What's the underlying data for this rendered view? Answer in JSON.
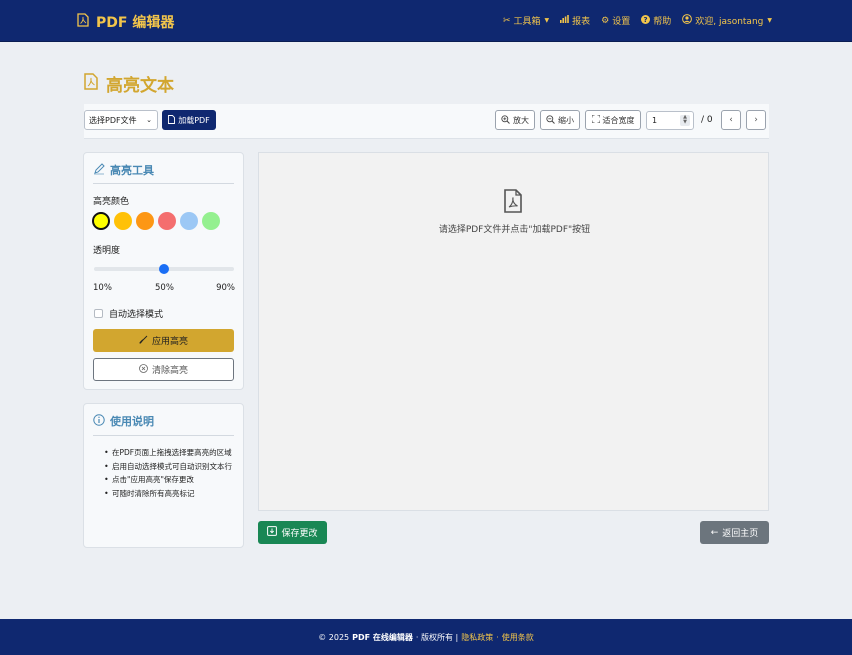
{
  "colors": {
    "navbar_bg": "#0f2870",
    "brand_gold": "#f2c54b",
    "title_gold": "#d2a62f",
    "card_title_blue": "#4a89b4",
    "save_green": "#198754",
    "home_gray": "#6c757d",
    "slider_blue": "#1a6ef5"
  },
  "navbar": {
    "brand": "PDF 编辑器",
    "brand_icon": "file-pdf-icon",
    "items": [
      {
        "label": "工具箱",
        "icon": "tools-icon",
        "dropdown": true
      },
      {
        "label": "报表",
        "icon": "bar-chart-icon",
        "dropdown": false
      },
      {
        "label": "设置",
        "icon": "gear-icon",
        "dropdown": false
      },
      {
        "label": "帮助",
        "icon": "question-circle-icon",
        "dropdown": false
      }
    ],
    "user": {
      "label": "欢迎, jasontang",
      "icon": "user-circle-icon",
      "dropdown": true
    }
  },
  "page": {
    "title": "高亮文本",
    "title_icon": "file-pdf-icon"
  },
  "toolbar": {
    "select_value": "选择PDF文件",
    "load_label": "加载PDF",
    "zoom_in_label": "放大",
    "zoom_out_label": "缩小",
    "fit_width_label": "适合宽度",
    "page_number": "1",
    "page_total": "/ 0",
    "prev_icon": "chevron-left-icon",
    "next_icon": "chevron-right-icon"
  },
  "highlight_tools": {
    "title": "高亮工具",
    "color_label": "高亮颜色",
    "colors": [
      "#ffff00",
      "#ffc107",
      "#fd9714",
      "#f46e6e",
      "#9cc8f5",
      "#94f08f"
    ],
    "selected_color_index": 0,
    "opacity_label": "透明度",
    "opacity_value": 0.5,
    "opacity_ticks": [
      "10%",
      "50%",
      "90%"
    ],
    "auto_select_label": "自动选择模式",
    "auto_select_checked": false,
    "apply_label": "应用高亮",
    "clear_label": "清除高亮"
  },
  "instructions": {
    "title": "使用说明",
    "items": [
      "在PDF页面上拖拽选择要高亮的区域",
      "启用自动选择模式可自动识别文本行",
      "点击\"应用高亮\"保存更改",
      "可随时清除所有高亮标记"
    ]
  },
  "viewer": {
    "empty_message": "请选择PDF文件并点击\"加载PDF\"按钮"
  },
  "actions": {
    "save_label": "保存更改",
    "home_label": "返回主页"
  },
  "footer": {
    "copyright": "© 2025",
    "brand": "PDF 在线编辑器",
    "rights": "· 版权所有 |",
    "privacy": "隐私政策",
    "dot": "·",
    "terms": "使用条款"
  }
}
